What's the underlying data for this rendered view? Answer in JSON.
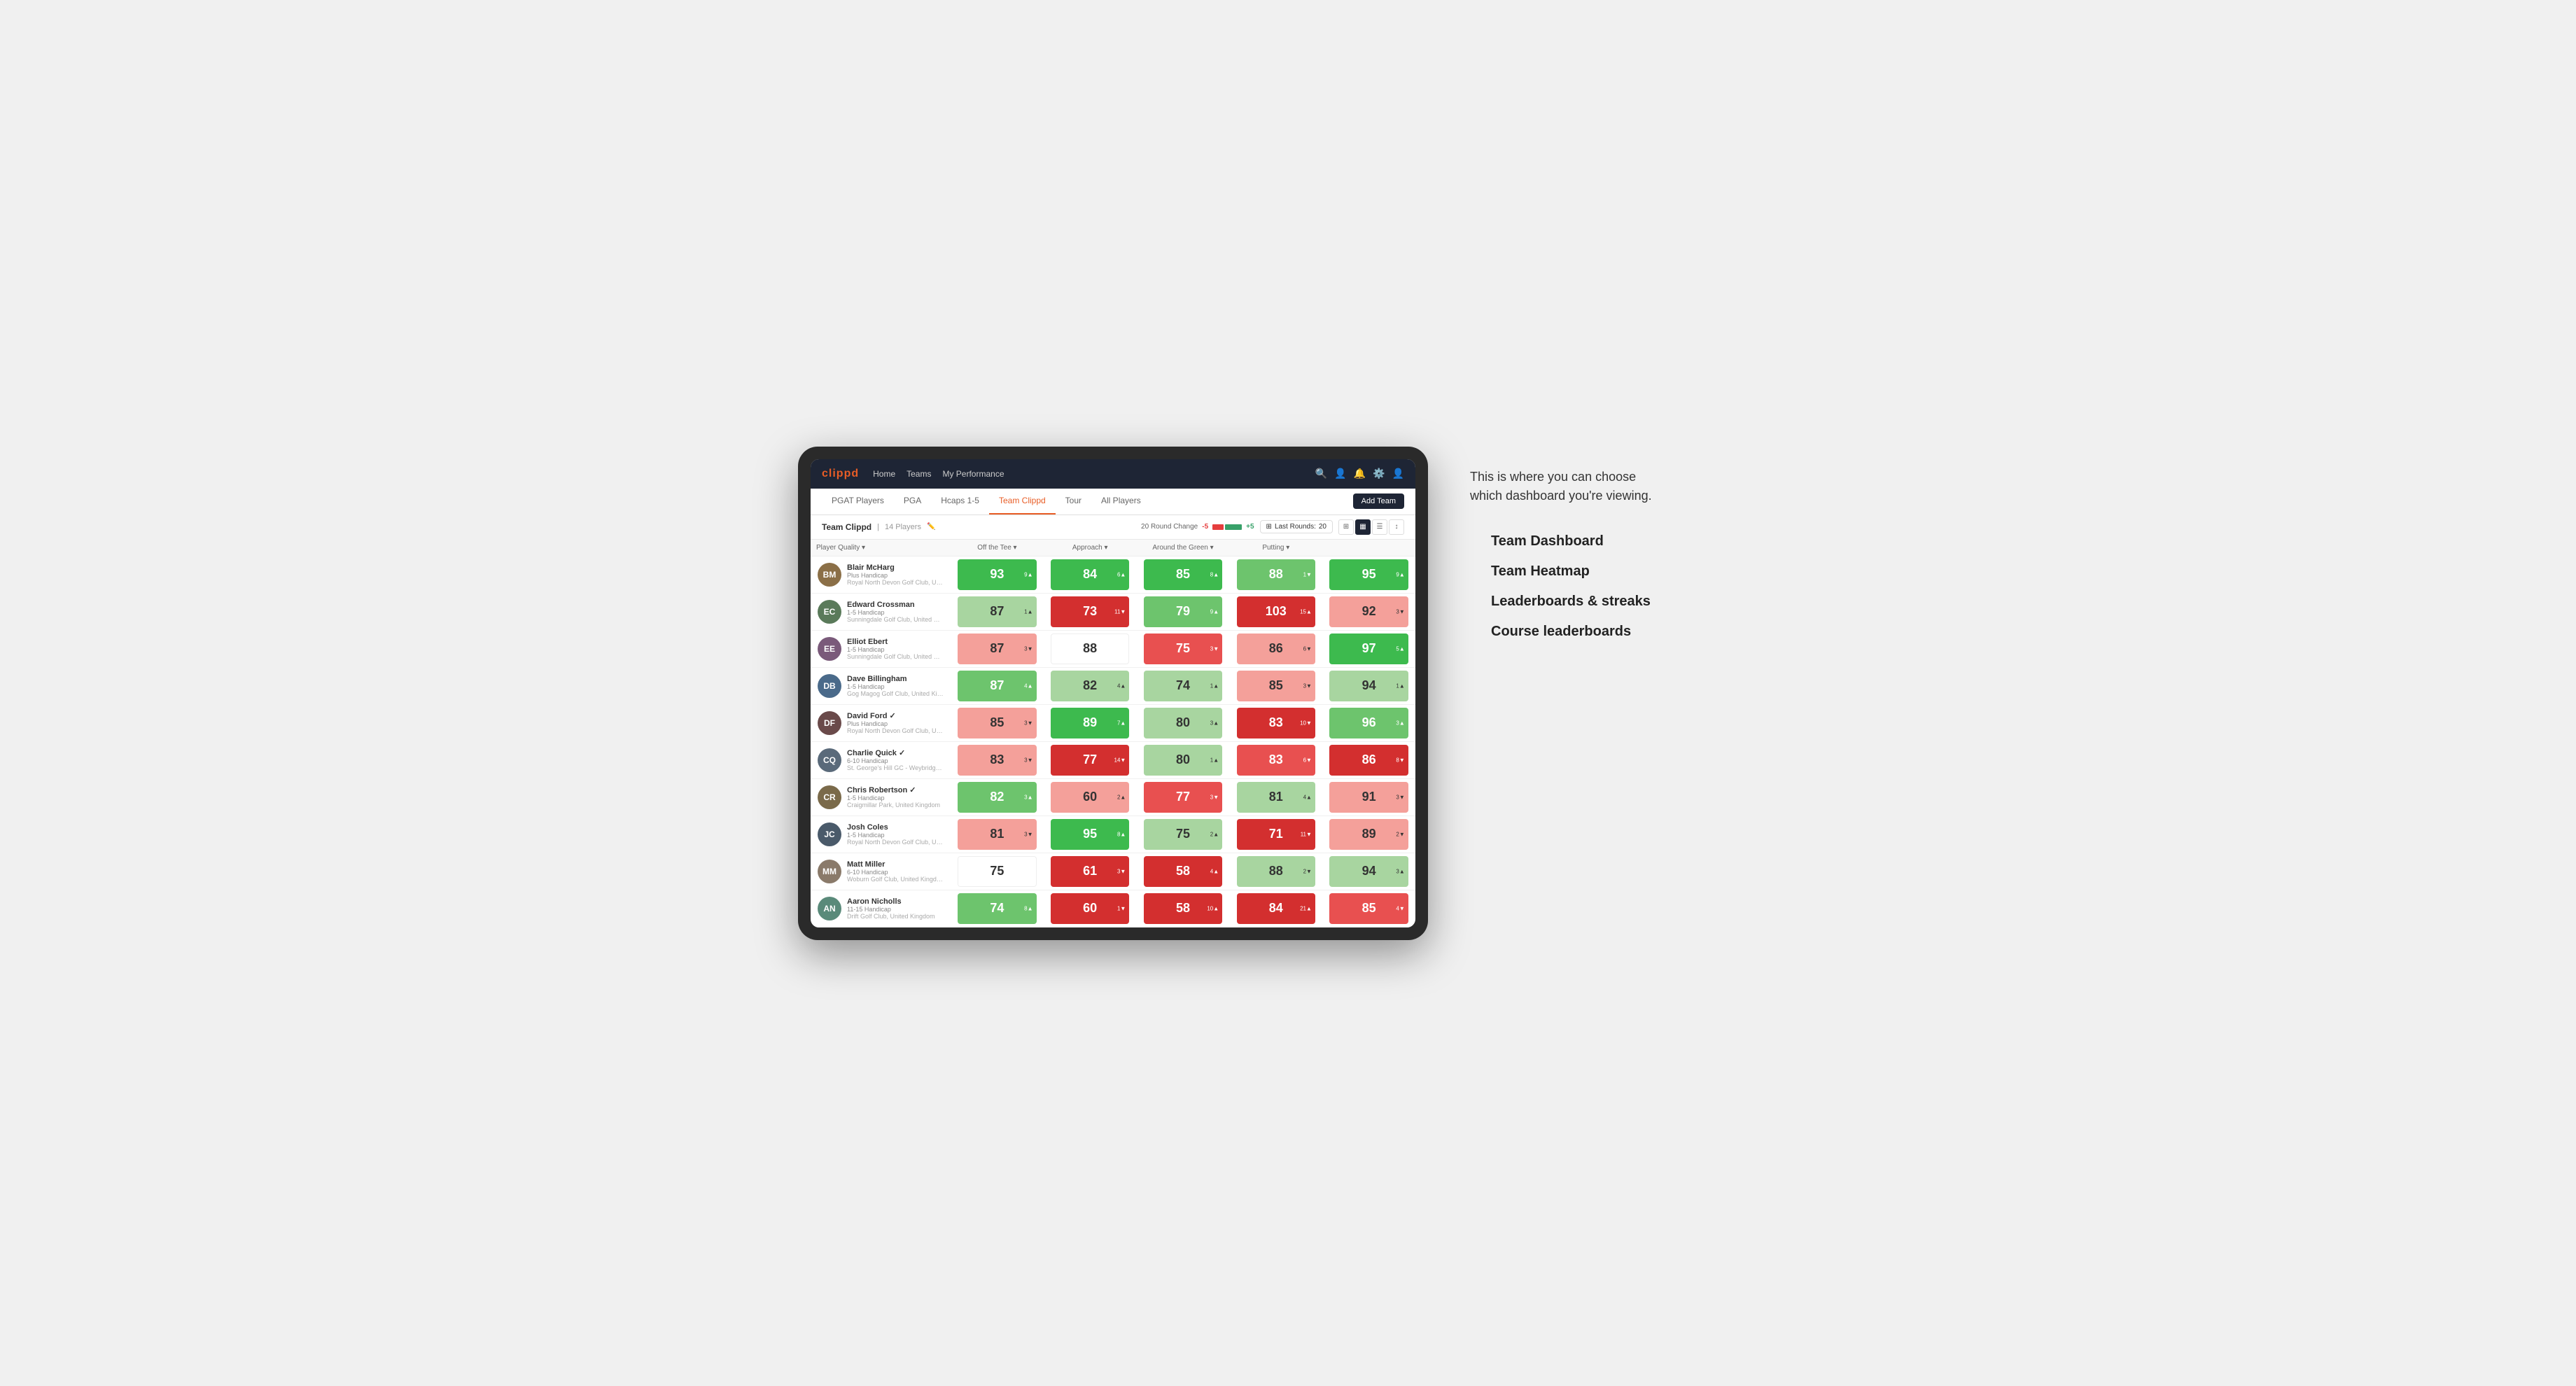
{
  "annotation": {
    "intro_text": "This is where you can choose which dashboard you're viewing.",
    "items": [
      {
        "label": "Team Dashboard"
      },
      {
        "label": "Team Heatmap"
      },
      {
        "label": "Leaderboards & streaks"
      },
      {
        "label": "Course leaderboards"
      }
    ]
  },
  "navbar": {
    "logo": "clippd",
    "links": [
      "Home",
      "Teams",
      "My Performance"
    ],
    "icons": [
      "search",
      "user",
      "bell",
      "settings",
      "profile"
    ]
  },
  "subnav": {
    "tabs": [
      "PGAT Players",
      "PGA",
      "Hcaps 1-5",
      "Team Clippd",
      "Tour",
      "All Players"
    ],
    "active_tab": "Team Clippd",
    "add_button": "Add Team"
  },
  "team_header": {
    "name": "Team Clippd",
    "separator": "|",
    "count": "14 Players",
    "round_change_label": "20 Round Change",
    "change_value_neg": "-5",
    "change_value_pos": "+5",
    "last_rounds_label": "Last Rounds:",
    "last_rounds_value": "20"
  },
  "columns": {
    "player": "Player Quality ▾",
    "off_tee": "Off the Tee ▾",
    "approach": "Approach ▾",
    "around_green": "Around the Green ▾",
    "putting": "Putting ▾"
  },
  "players": [
    {
      "name": "Blair McHarg",
      "handicap": "Plus Handicap",
      "club": "Royal North Devon Golf Club, United Kingdom",
      "initials": "BM",
      "avatar_color": "#8B6F47",
      "scores": [
        {
          "value": "93",
          "change": "9▲",
          "bg": "bg-green-bright",
          "text": "white"
        },
        {
          "value": "84",
          "change": "6▲",
          "bg": "bg-green-bright",
          "text": "white"
        },
        {
          "value": "85",
          "change": "8▲",
          "bg": "bg-green-bright",
          "text": "white"
        },
        {
          "value": "88",
          "change": "1▼",
          "bg": "bg-green-mid",
          "text": "white"
        },
        {
          "value": "95",
          "change": "9▲",
          "bg": "bg-green-bright",
          "text": "white"
        }
      ]
    },
    {
      "name": "Edward Crossman",
      "handicap": "1-5 Handicap",
      "club": "Sunningdale Golf Club, United Kingdom",
      "initials": "EC",
      "avatar_color": "#5a7a5a",
      "scores": [
        {
          "value": "87",
          "change": "1▲",
          "bg": "bg-green-light",
          "text": "dark"
        },
        {
          "value": "73",
          "change": "11▼",
          "bg": "bg-red-bright",
          "text": "white"
        },
        {
          "value": "79",
          "change": "9▲",
          "bg": "bg-green-mid",
          "text": "white"
        },
        {
          "value": "103",
          "change": "15▲",
          "bg": "bg-red-bright",
          "text": "white"
        },
        {
          "value": "92",
          "change": "3▼",
          "bg": "bg-red-light",
          "text": "dark"
        }
      ]
    },
    {
      "name": "Elliot Ebert",
      "handicap": "1-5 Handicap",
      "club": "Sunningdale Golf Club, United Kingdom",
      "initials": "EE",
      "avatar_color": "#7a5a7a",
      "scores": [
        {
          "value": "87",
          "change": "3▼",
          "bg": "bg-red-light",
          "text": "dark"
        },
        {
          "value": "88",
          "change": "",
          "bg": "bg-white",
          "text": "dark"
        },
        {
          "value": "75",
          "change": "3▼",
          "bg": "bg-red-mid",
          "text": "white"
        },
        {
          "value": "86",
          "change": "6▼",
          "bg": "bg-red-light",
          "text": "dark"
        },
        {
          "value": "97",
          "change": "5▲",
          "bg": "bg-green-bright",
          "text": "white"
        }
      ]
    },
    {
      "name": "Dave Billingham",
      "handicap": "1-5 Handicap",
      "club": "Gog Magog Golf Club, United Kingdom",
      "initials": "DB",
      "avatar_color": "#4a6a8a",
      "scores": [
        {
          "value": "87",
          "change": "4▲",
          "bg": "bg-green-mid",
          "text": "white"
        },
        {
          "value": "82",
          "change": "4▲",
          "bg": "bg-green-light",
          "text": "dark"
        },
        {
          "value": "74",
          "change": "1▲",
          "bg": "bg-green-light",
          "text": "dark"
        },
        {
          "value": "85",
          "change": "3▼",
          "bg": "bg-red-light",
          "text": "dark"
        },
        {
          "value": "94",
          "change": "1▲",
          "bg": "bg-green-light",
          "text": "dark"
        }
      ]
    },
    {
      "name": "David Ford",
      "handicap": "Plus Handicap",
      "club": "Royal North Devon Golf Club, United Kingdom",
      "initials": "DF",
      "avatar_color": "#6a4a4a",
      "verified": true,
      "scores": [
        {
          "value": "85",
          "change": "3▼",
          "bg": "bg-red-light",
          "text": "dark"
        },
        {
          "value": "89",
          "change": "7▲",
          "bg": "bg-green-bright",
          "text": "white"
        },
        {
          "value": "80",
          "change": "3▲",
          "bg": "bg-green-light",
          "text": "dark"
        },
        {
          "value": "83",
          "change": "10▼",
          "bg": "bg-red-bright",
          "text": "white"
        },
        {
          "value": "96",
          "change": "3▲",
          "bg": "bg-green-mid",
          "text": "white"
        }
      ]
    },
    {
      "name": "Charlie Quick",
      "handicap": "6-10 Handicap",
      "club": "St. George's Hill GC - Weybridge - Surrey, Uni...",
      "initials": "CQ",
      "avatar_color": "#5a6a7a",
      "verified": true,
      "scores": [
        {
          "value": "83",
          "change": "3▼",
          "bg": "bg-red-light",
          "text": "dark"
        },
        {
          "value": "77",
          "change": "14▼",
          "bg": "bg-red-bright",
          "text": "white"
        },
        {
          "value": "80",
          "change": "1▲",
          "bg": "bg-green-light",
          "text": "dark"
        },
        {
          "value": "83",
          "change": "6▼",
          "bg": "bg-red-mid",
          "text": "white"
        },
        {
          "value": "86",
          "change": "8▼",
          "bg": "bg-red-bright",
          "text": "white"
        }
      ]
    },
    {
      "name": "Chris Robertson",
      "handicap": "1-5 Handicap",
      "club": "Craigmillar Park, United Kingdom",
      "initials": "CR",
      "avatar_color": "#7a6a4a",
      "verified": true,
      "scores": [
        {
          "value": "82",
          "change": "3▲",
          "bg": "bg-green-mid",
          "text": "white"
        },
        {
          "value": "60",
          "change": "2▲",
          "bg": "bg-red-light",
          "text": "dark"
        },
        {
          "value": "77",
          "change": "3▼",
          "bg": "bg-red-mid",
          "text": "white"
        },
        {
          "value": "81",
          "change": "4▲",
          "bg": "bg-green-light",
          "text": "dark"
        },
        {
          "value": "91",
          "change": "3▼",
          "bg": "bg-red-light",
          "text": "dark"
        }
      ]
    },
    {
      "name": "Josh Coles",
      "handicap": "1-5 Handicap",
      "club": "Royal North Devon Golf Club, United Kingdom",
      "initials": "JC",
      "avatar_color": "#4a5a6a",
      "scores": [
        {
          "value": "81",
          "change": "3▼",
          "bg": "bg-red-light",
          "text": "dark"
        },
        {
          "value": "95",
          "change": "8▲",
          "bg": "bg-green-bright",
          "text": "white"
        },
        {
          "value": "75",
          "change": "2▲",
          "bg": "bg-green-light",
          "text": "dark"
        },
        {
          "value": "71",
          "change": "11▼",
          "bg": "bg-red-bright",
          "text": "white"
        },
        {
          "value": "89",
          "change": "2▼",
          "bg": "bg-red-light",
          "text": "dark"
        }
      ]
    },
    {
      "name": "Matt Miller",
      "handicap": "6-10 Handicap",
      "club": "Woburn Golf Club, United Kingdom",
      "initials": "MM",
      "avatar_color": "#8a7a6a",
      "scores": [
        {
          "value": "75",
          "change": "",
          "bg": "bg-white",
          "text": "dark"
        },
        {
          "value": "61",
          "change": "3▼",
          "bg": "bg-red-bright",
          "text": "white"
        },
        {
          "value": "58",
          "change": "4▲",
          "bg": "bg-red-bright",
          "text": "white"
        },
        {
          "value": "88",
          "change": "2▼",
          "bg": "bg-green-light",
          "text": "dark"
        },
        {
          "value": "94",
          "change": "3▲",
          "bg": "bg-green-light",
          "text": "dark"
        }
      ]
    },
    {
      "name": "Aaron Nicholls",
      "handicap": "11-15 Handicap",
      "club": "Drift Golf Club, United Kingdom",
      "initials": "AN",
      "avatar_color": "#5a8a7a",
      "scores": [
        {
          "value": "74",
          "change": "8▲",
          "bg": "bg-green-mid",
          "text": "white"
        },
        {
          "value": "60",
          "change": "1▼",
          "bg": "bg-red-bright",
          "text": "white"
        },
        {
          "value": "58",
          "change": "10▲",
          "bg": "bg-red-bright",
          "text": "white"
        },
        {
          "value": "84",
          "change": "21▲",
          "bg": "bg-red-bright",
          "text": "white"
        },
        {
          "value": "85",
          "change": "4▼",
          "bg": "bg-red-mid",
          "text": "white"
        }
      ]
    }
  ]
}
